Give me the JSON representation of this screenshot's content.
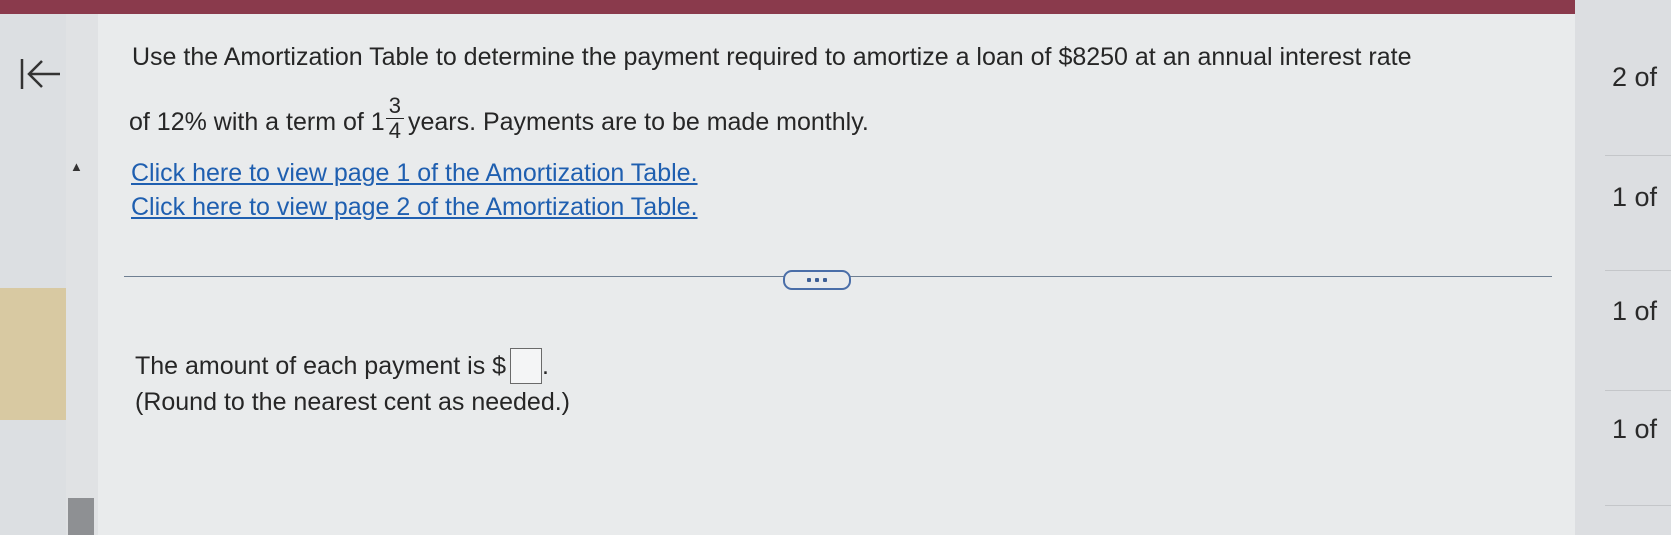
{
  "question": {
    "line1": "Use the Amortization Table to determine the payment required to amortize a loan of $8250 at an annual interest rate",
    "line2_prefix": "of 12% with a term of 1",
    "frac_num": "3",
    "frac_den": "4",
    "line2_suffix": " years. Payments are to be made monthly."
  },
  "links": {
    "page1": "Click here to view page 1 of the Amortization Table.",
    "page2": "Click here to view page 2 of the Amortization Table."
  },
  "answer": {
    "label": "The amount of each payment is $",
    "value": "",
    "hint": "(Round to the nearest cent as needed.)"
  },
  "right_panel": {
    "items": [
      "2 of",
      "1 of",
      "1 of",
      "1 of"
    ]
  },
  "colors": {
    "top_bar": "#8a3a4c",
    "link": "#1f5fb0",
    "left_highlight": "#d8c9a2"
  },
  "icons": {
    "back": "arrow-to-left-icon",
    "more": "ellipsis-icon",
    "scroll_up": "triangle-up-icon"
  }
}
